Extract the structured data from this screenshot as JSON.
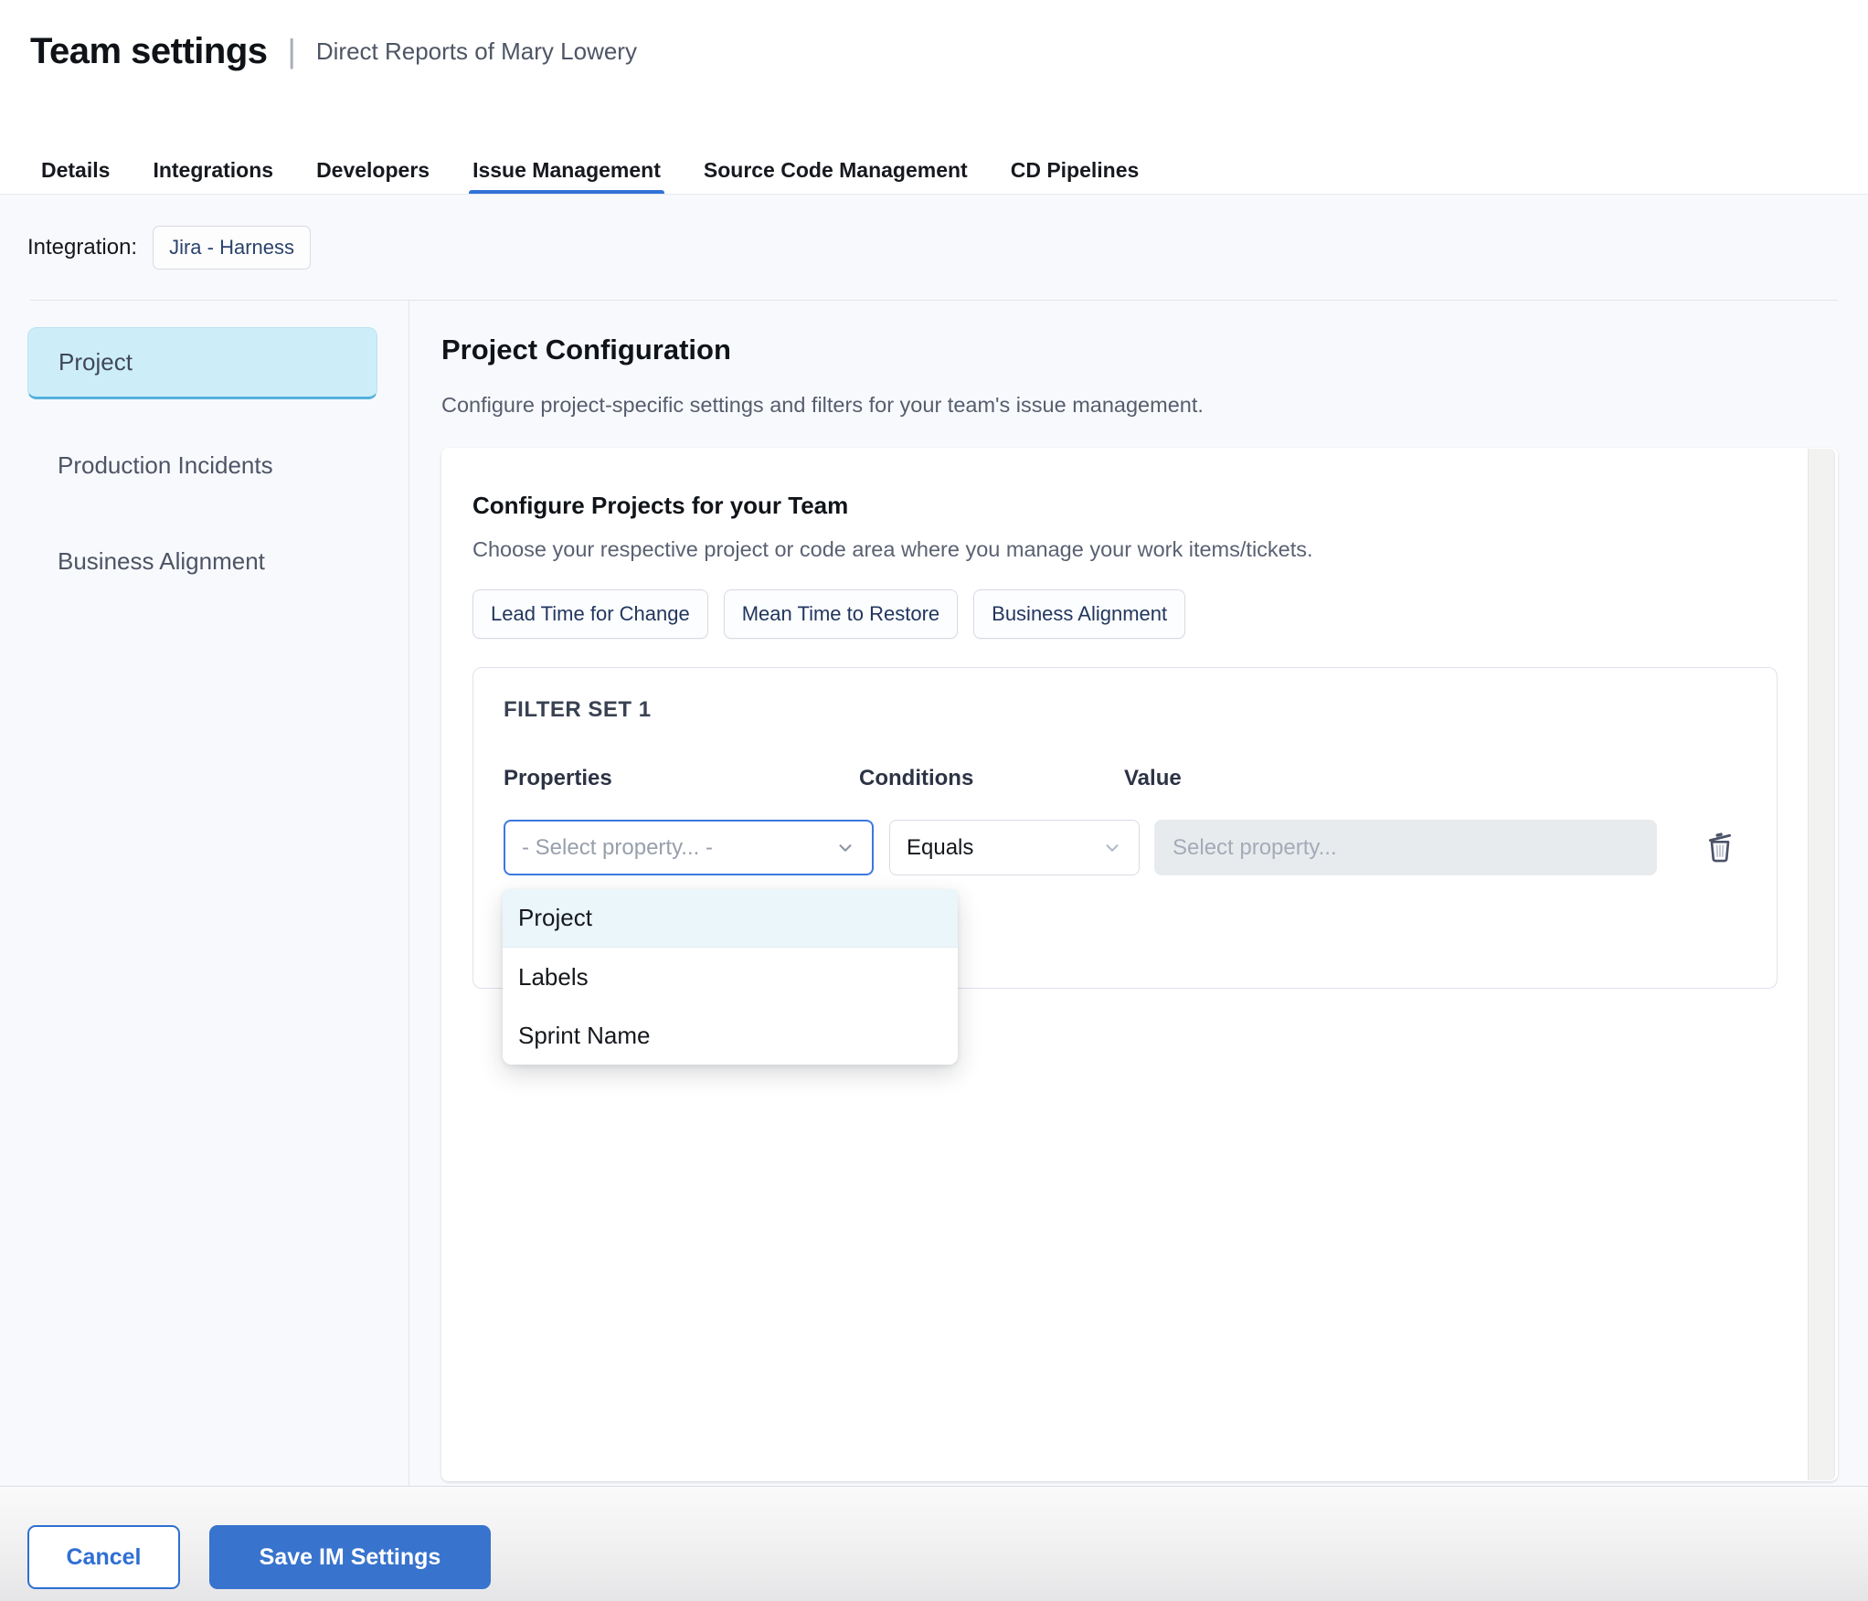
{
  "header": {
    "title": "Team settings",
    "divider": "|",
    "subtitle": "Direct Reports of Mary Lowery"
  },
  "tabs": [
    {
      "label": "Details",
      "active": false
    },
    {
      "label": "Integrations",
      "active": false
    },
    {
      "label": "Developers",
      "active": false
    },
    {
      "label": "Issue Management",
      "active": true
    },
    {
      "label": "Source Code Management",
      "active": false
    },
    {
      "label": "CD Pipelines",
      "active": false
    }
  ],
  "integration": {
    "label": "Integration:",
    "chip": "Jira - Harness"
  },
  "sidebar": {
    "items": [
      {
        "label": "Project",
        "active": true
      },
      {
        "label": "Production Incidents",
        "active": false
      },
      {
        "label": "Business Alignment",
        "active": false
      }
    ]
  },
  "main": {
    "title": "Project Configuration",
    "subtitle": "Configure project-specific settings and filters for your team's issue management."
  },
  "card": {
    "title": "Configure Projects for your Team",
    "subtitle": "Choose your respective project or code area where you manage your work items/tickets.",
    "chips": [
      {
        "label": "Lead Time for Change"
      },
      {
        "label": "Mean Time to Restore"
      },
      {
        "label": "Business Alignment"
      }
    ]
  },
  "filter_set": {
    "title": "FILTER SET 1",
    "columns": {
      "properties": "Properties",
      "conditions": "Conditions",
      "value": "Value"
    },
    "properties_placeholder": "- Select property... -",
    "conditions_value": "Equals",
    "value_placeholder": "Select property...",
    "options": [
      {
        "label": "Project",
        "highlighted": true
      },
      {
        "label": "Labels",
        "highlighted": false
      },
      {
        "label": "Sprint Name",
        "highlighted": false
      }
    ]
  },
  "footer": {
    "cancel_label": "Cancel",
    "save_label": "Save IM Settings"
  },
  "colors": {
    "accent": "#2f6fd3",
    "save-bg": "#3873cd",
    "tab-underline": "#3273d9",
    "focus-border": "#3b78e0",
    "sidebar-active-bg": "#cdeef9",
    "sidebar-active-border": "#55b1dc",
    "dropdown-highlight": "#ebf6fb"
  }
}
